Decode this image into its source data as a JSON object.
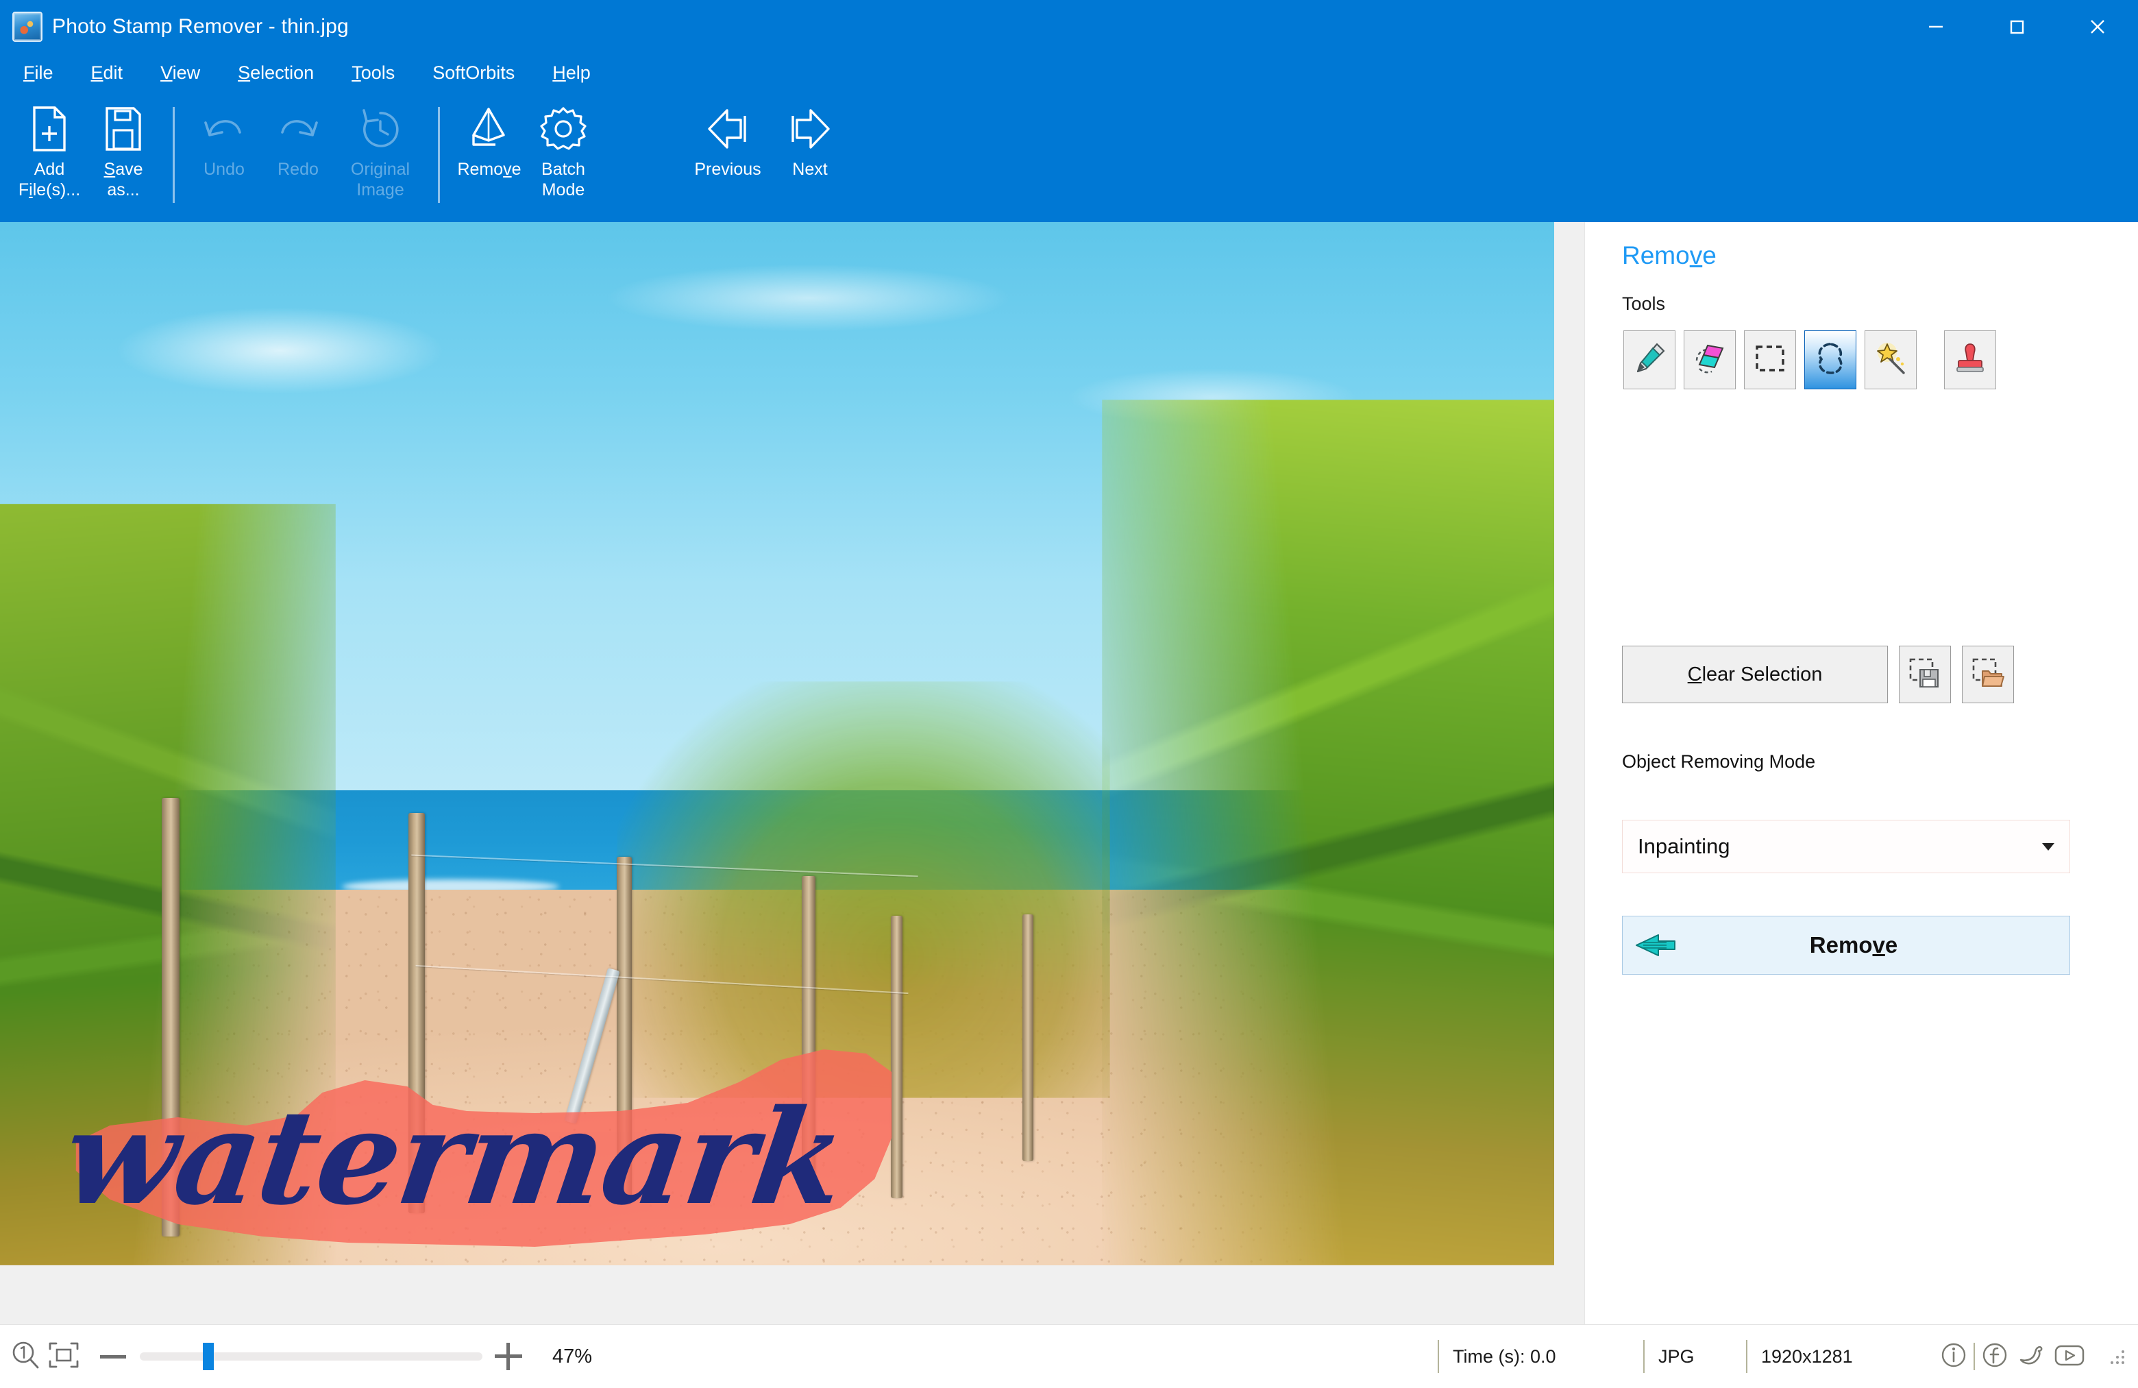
{
  "window": {
    "app_name": "Photo Stamp Remover",
    "file_name": "thin.jpg",
    "title": "Photo Stamp Remover - thin.jpg",
    "app_icon": "photo-app-icon",
    "controls": {
      "minimize": "minimize-icon",
      "maximize": "maximize-icon",
      "close": "close-icon"
    }
  },
  "menubar": {
    "items": [
      {
        "label": "File",
        "accel": "F"
      },
      {
        "label": "Edit",
        "accel": "E"
      },
      {
        "label": "View",
        "accel": "V"
      },
      {
        "label": "Selection",
        "accel": "S"
      },
      {
        "label": "SoftOrbits",
        "accel": ""
      },
      {
        "label": "Help",
        "accel": "H"
      }
    ]
  },
  "ribbon": {
    "buttons": [
      {
        "label": "Add\nFile(s)...",
        "icon": "add-file-icon",
        "enabled": true
      },
      {
        "label": "Save\nas...",
        "icon": "save-as-icon",
        "enabled": true
      },
      {
        "label": "Undo",
        "icon": "undo-icon",
        "enabled": false
      },
      {
        "label": "Redo",
        "icon": "redo-icon",
        "enabled": false
      },
      {
        "label": "Original\nImage",
        "icon": "original-image-icon",
        "enabled": false
      },
      {
        "label": "Remove",
        "icon": "eraser-icon",
        "enabled": true
      },
      {
        "label": "Batch\nMode",
        "icon": "gear-icon",
        "enabled": true
      },
      {
        "label": "Previous",
        "icon": "arrow-left-icon",
        "enabled": true
      },
      {
        "label": "Next",
        "icon": "arrow-right-icon",
        "enabled": true
      }
    ]
  },
  "canvas": {
    "image_description": "Beach dune path with wooden fence posts, marram grass and blue sea",
    "watermark_text": "watermark",
    "watermark_color": "#1f2a7a",
    "selection_overlay_color": "#f9695c",
    "selection_border": "marching-ants-dashed"
  },
  "panel": {
    "title": "Remove",
    "title_accel": "v",
    "tools_label": "Tools",
    "tools": [
      {
        "name": "marker-tool",
        "icon": "marker-pen-icon",
        "selected": false
      },
      {
        "name": "eraser-tool",
        "icon": "eraser-icon",
        "selected": false
      },
      {
        "name": "rectangle-select-tool",
        "icon": "rectangle-select-icon",
        "selected": false
      },
      {
        "name": "lasso-select-tool",
        "icon": "lasso-icon",
        "selected": true
      },
      {
        "name": "magic-wand-tool",
        "icon": "magic-wand-icon",
        "selected": false
      },
      {
        "name": "stamp-tool",
        "icon": "stamp-icon",
        "selected": false
      }
    ],
    "clear_selection_label": "Clear Selection",
    "clear_selection_accel": "C",
    "save_selection_icon": "save-selection-icon",
    "load_selection_icon": "load-selection-icon",
    "mode_label": "Object Removing Mode",
    "mode_value": "Inpainting",
    "remove_button_label": "Remove",
    "remove_button_accel": "v",
    "remove_button_icon": "arrow-right-thick-icon"
  },
  "statusbar": {
    "zoom_actual_icon": "zoom-1to1-icon",
    "zoom_fit_icon": "fit-to-window-icon",
    "zoom_out_icon": "minus-icon",
    "zoom_in_icon": "plus-icon",
    "zoom_percent": "47%",
    "zoom_slider_value": 47,
    "time_label": "Time (s): 0.0",
    "format": "JPG",
    "dimensions": "1920x1281",
    "icons": [
      {
        "name": "info-icon"
      },
      {
        "name": "facebook-icon"
      },
      {
        "name": "twitter-icon"
      },
      {
        "name": "youtube-icon"
      },
      {
        "name": "resize-grip-icon"
      }
    ]
  },
  "colors": {
    "accent": "#0078d4",
    "panel_title": "#1f9af5",
    "tool_active": "#2f93e0",
    "slider_thumb": "#0a84e0"
  }
}
